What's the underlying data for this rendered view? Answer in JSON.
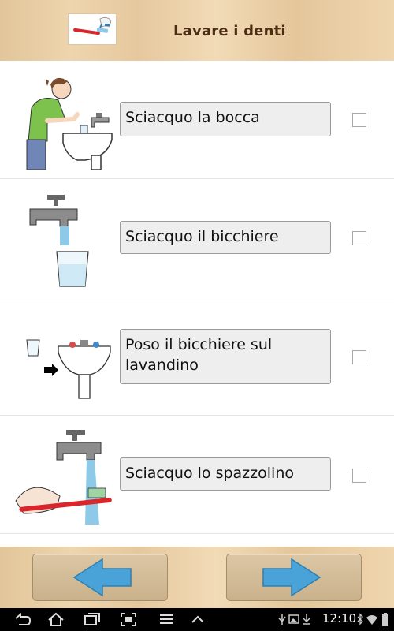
{
  "header": {
    "title": "Lavare i denti",
    "image_icon": "toothbrush-with-paste-icon"
  },
  "steps": [
    {
      "label": "Sciacquo la bocca",
      "icon": "girl-rinsing-mouth-at-sink-icon",
      "checked": false
    },
    {
      "label": "Sciacquo il bicchiere",
      "icon": "tap-filling-glass-icon",
      "checked": false
    },
    {
      "label": "Poso il bicchiere sul lavandino",
      "icon": "glass-onto-sink-icon",
      "checked": false
    },
    {
      "label": "Sciacquo lo spazzolino",
      "icon": "toothbrush-under-tap-icon",
      "checked": false
    }
  ],
  "footer": {
    "back_icon": "arrow-left-icon",
    "forward_icon": "arrow-right-icon",
    "arrow_color": "#4aa3d8"
  },
  "status_bar": {
    "time": "12:10",
    "nav_icons": [
      "back-icon",
      "home-icon",
      "recent-apps-icon",
      "screenshot-icon",
      "menu-icon",
      "up-chevron-icon"
    ],
    "status_icons": [
      "usb-icon",
      "gallery-icon",
      "download-icon",
      "bluetooth-icon",
      "wifi-icon",
      "battery-icon"
    ]
  }
}
